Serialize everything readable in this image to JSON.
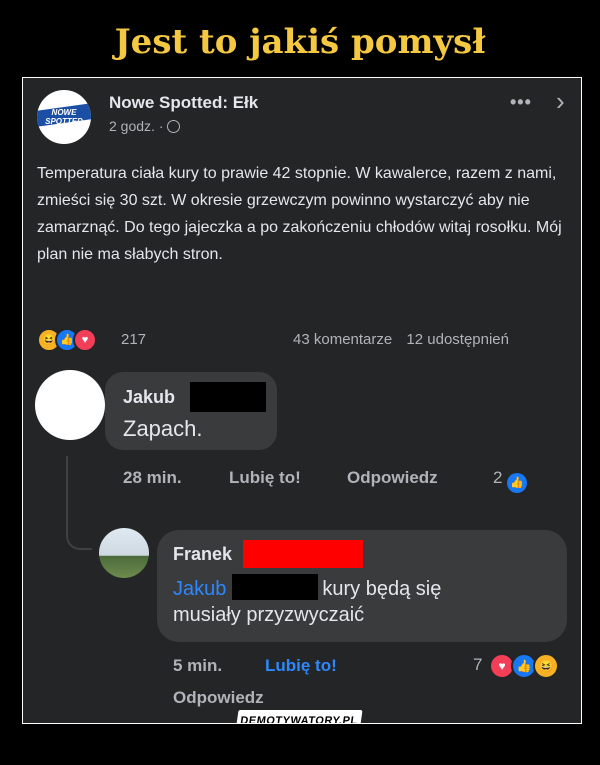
{
  "page_title": "Jest to jakiś pomysł",
  "post": {
    "logo_text": "NOWE SPOTTED EŁK",
    "author": "Nowe Spotted: Ełk",
    "time": "2 godz. ·",
    "more_icon": "more-dots-icon",
    "body": "Temperatura ciała kury to prawie 42 stopnie. W kawalerce, razem z nami, zmieści się 30 szt. W okresie grzewczym powinno wystarczyć aby nie zamarznąć. Do tego jajeczka a po zakończeniu chłodów witaj rosołku. Mój plan nie ma słabych stron.",
    "reactions_count": "217",
    "comments_count": "43 komentarze",
    "shares_count": "12 udostępnień",
    "reaction_icons": [
      "haha-icon",
      "like-icon",
      "love-icon"
    ]
  },
  "comment1": {
    "author": "Jakub",
    "text": "Zapach.",
    "time": "28 min.",
    "like_label": "Lubię to!",
    "reply_label": "Odpowiedz",
    "reactions_count": "2"
  },
  "comment2": {
    "author": "Franek",
    "mention": "Jakub",
    "text_after": "kury będą się",
    "text_line2": "musiały przyzwyczaić",
    "time": "5 min.",
    "like_label": "Lubię to!",
    "reply_label": "Odpowiedz",
    "reactions_count": "7"
  },
  "watermark": "DEMOTYWATORY.PL",
  "colors": {
    "title": "#f5c842",
    "card_bg": "#242526",
    "bubble_bg": "#3a3b3c",
    "facebook_blue": "#1877f2",
    "mention_blue": "#2d88ff",
    "redaction_red": "#ff0000"
  }
}
